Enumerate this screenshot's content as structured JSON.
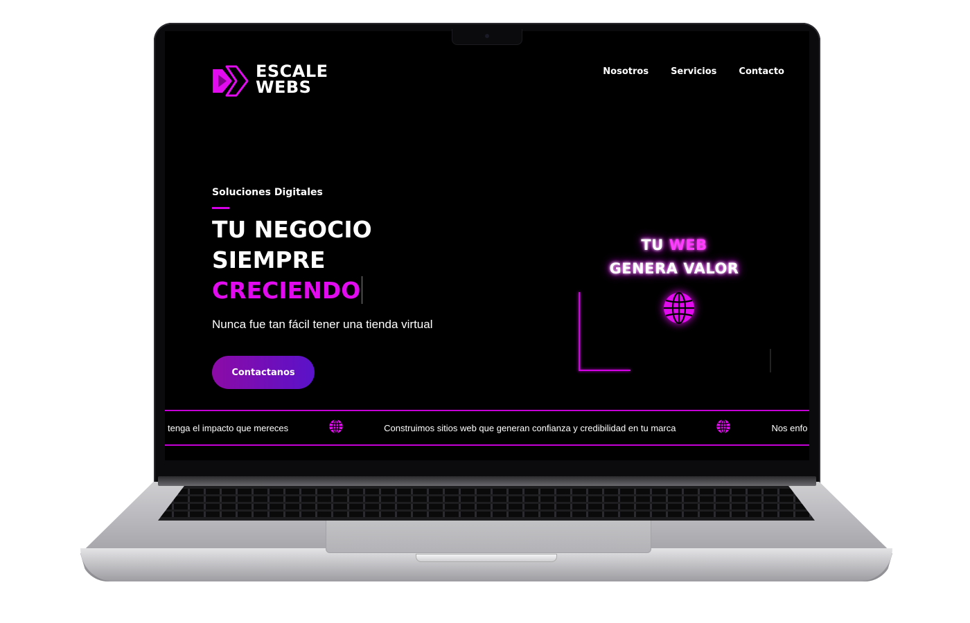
{
  "brand": {
    "line1": "ESCALE",
    "line2": "WEBS",
    "accent_color": "#e20bf0"
  },
  "nav": {
    "items": [
      "Nosotros",
      "Servicios",
      "Contacto"
    ]
  },
  "hero": {
    "eyebrow": "Soluciones Digitales",
    "headline_line1": "TU NEGOCIO",
    "headline_line2": "SIEMPRE",
    "headline_line3": "CRECIENDO",
    "subtitle": "Nunca fue tan fácil tener una tienda virtual",
    "cta_label": "Contactanos"
  },
  "promo": {
    "word1": "TU",
    "word2": "WEB",
    "line2": "GENERA VALOR",
    "icon": "globe-icon"
  },
  "ticker": {
    "items": [
      "tenga el impacto que mereces",
      "Construimos sitios web que generan confianza y credibilidad en tu marca",
      "Nos enfo"
    ],
    "separator_icon": "globe-icon"
  },
  "colors": {
    "background": "#000000",
    "accent": "#e20bf0",
    "button_gradient_start": "#8c0ba6",
    "button_gradient_end": "#5a12c9"
  }
}
